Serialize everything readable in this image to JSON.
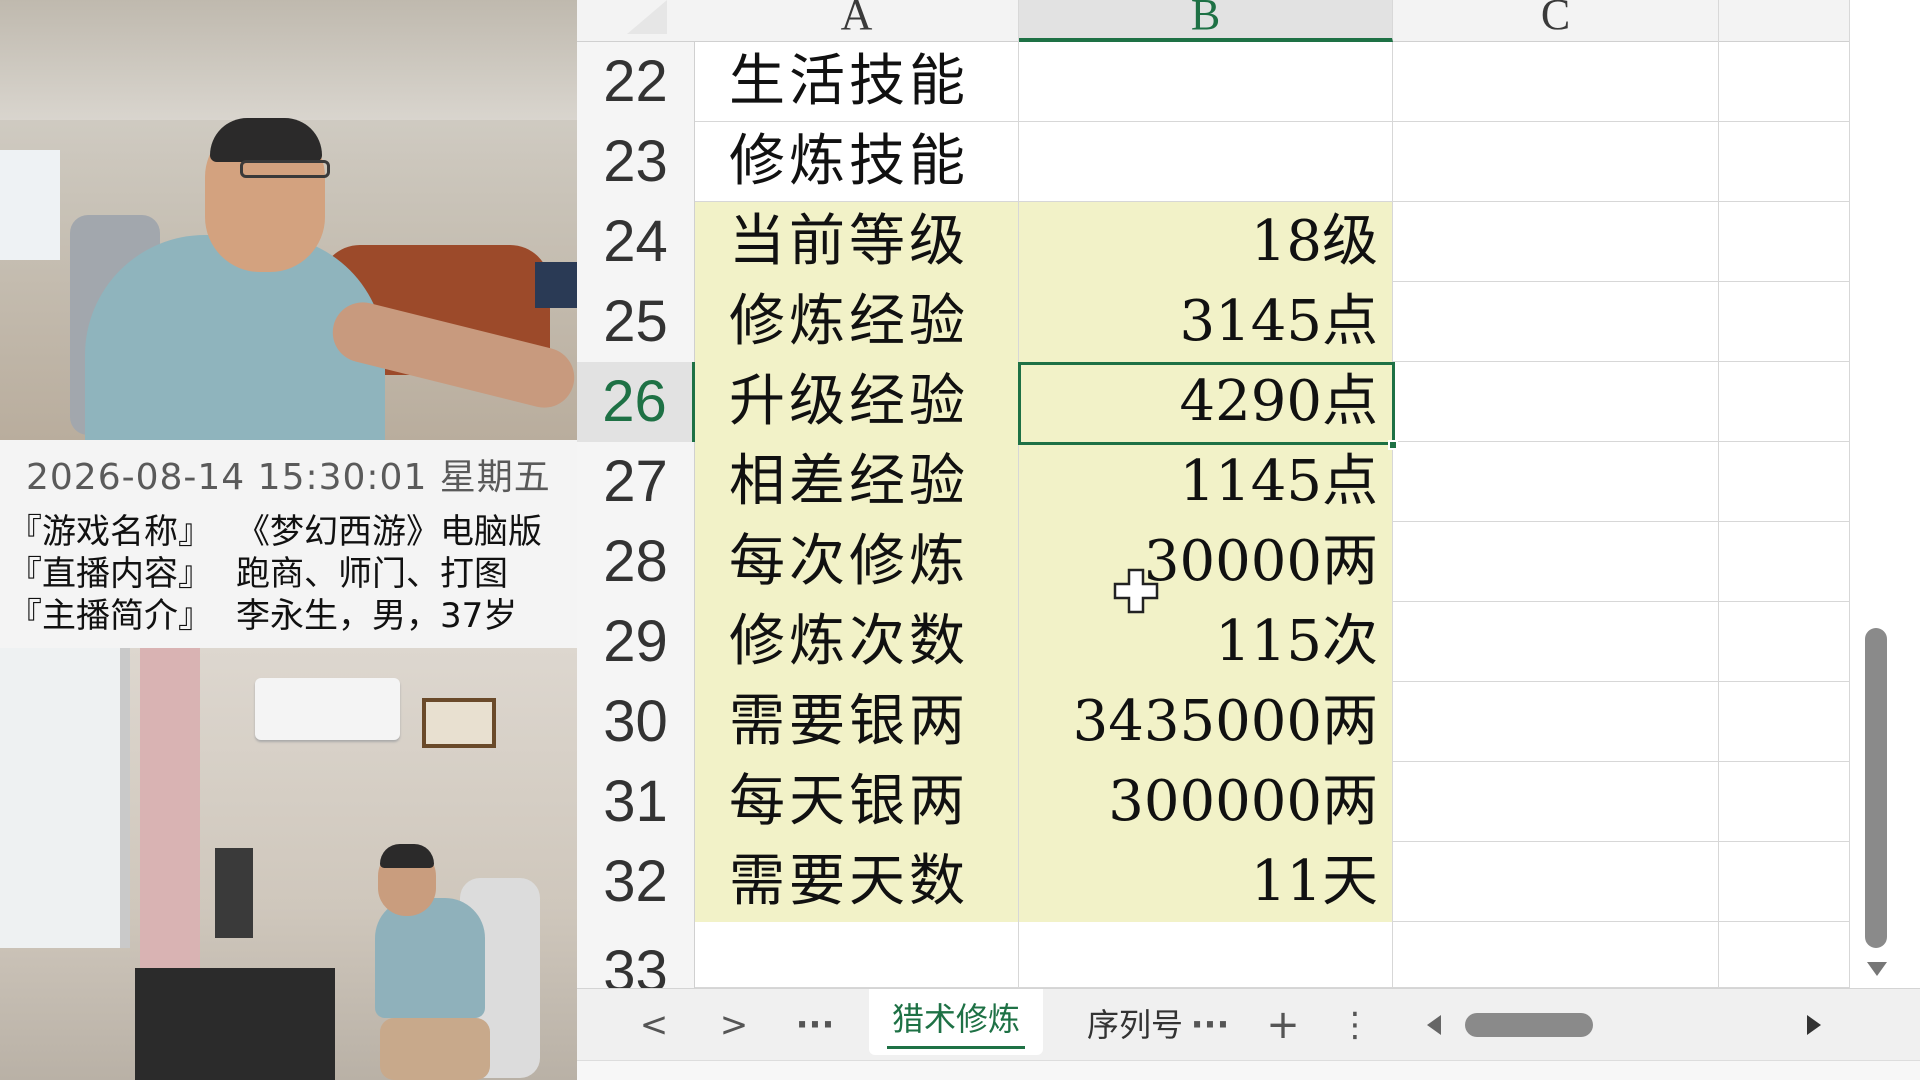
{
  "overlay": {
    "timestamp": "2026-08-14 15:30:01 星期五",
    "info_lines": [
      {
        "key": "『游戏名称』",
        "value": "《梦幻西游》电脑版"
      },
      {
        "key": "『直播内容』",
        "value": "跑商、师门、打图"
      },
      {
        "key": "『主播简介』",
        "value": "李永生，男，37岁"
      }
    ]
  },
  "spreadsheet": {
    "columns": [
      "A",
      "B",
      "C"
    ],
    "rows": [
      {
        "num": "22",
        "a": "生活技能",
        "b": ""
      },
      {
        "num": "23",
        "a": "修炼技能",
        "b": ""
      },
      {
        "num": "24",
        "a": "当前等级",
        "b": "18级"
      },
      {
        "num": "25",
        "a": "修炼经验",
        "b": "3145点"
      },
      {
        "num": "26",
        "a": "升级经验",
        "b": "4290点"
      },
      {
        "num": "27",
        "a": "相差经验",
        "b": "1145点"
      },
      {
        "num": "28",
        "a": "每次修炼",
        "b": "30000两"
      },
      {
        "num": "29",
        "a": "修炼次数",
        "b": "115次"
      },
      {
        "num": "30",
        "a": "需要银两",
        "b": "3435000两"
      },
      {
        "num": "31",
        "a": "每天银两",
        "b": "300000两"
      },
      {
        "num": "32",
        "a": "需要天数",
        "b": "11天"
      },
      {
        "num": "33",
        "a": "",
        "b": ""
      }
    ],
    "highlight_color": "#f2f2c8",
    "accent_color": "#1e7145"
  },
  "tab_bar": {
    "prev": "<",
    "next": ">",
    "more_left": "···",
    "active_tab": "猎术修炼",
    "second_tab": "序列号",
    "more_right": "···",
    "add": "+",
    "menu": "⋮"
  }
}
